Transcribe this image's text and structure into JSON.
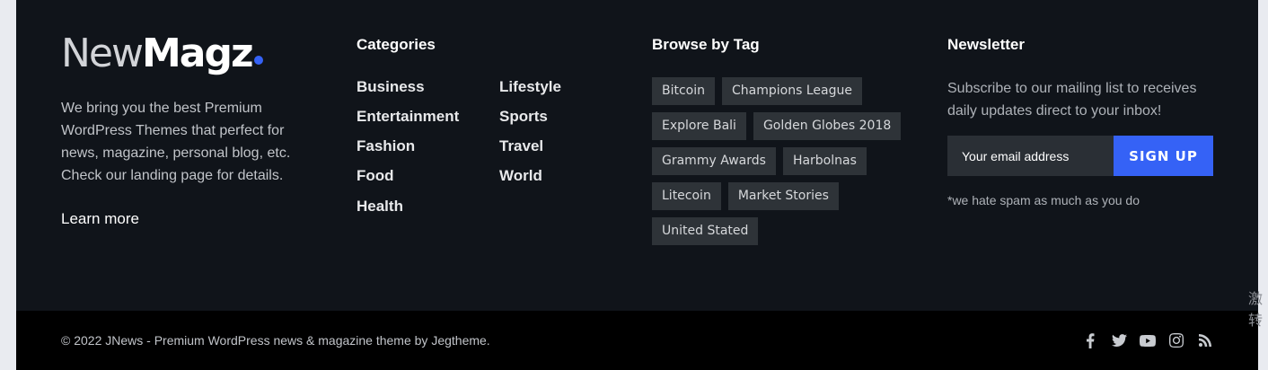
{
  "brand": {
    "logo_part1": "New",
    "logo_part2": "Magz"
  },
  "about": {
    "text": "We bring you the best Premium WordPress Themes that perfect for news, magazine, personal blog, etc. Check our landing page for details.",
    "learn_more": "Learn more"
  },
  "categories": {
    "title": "Categories",
    "col1": [
      "Business",
      "Entertainment",
      "Fashion",
      "Food",
      "Health"
    ],
    "col2": [
      "Lifestyle",
      "Sports",
      "Travel",
      "World"
    ]
  },
  "tags": {
    "title": "Browse by Tag",
    "items": [
      "Bitcoin",
      "Champions League",
      "Explore Bali",
      "Golden Globes 2018",
      "Grammy Awards",
      "Harbolnas",
      "Litecoin",
      "Market Stories",
      "United Stated"
    ]
  },
  "newsletter": {
    "title": "Newsletter",
    "description": "Subscribe to our mailing list to receives daily updates direct to your inbox!",
    "email_placeholder": "Your email address",
    "signup_label": "SIGN UP",
    "note": "*we hate spam as much as you do"
  },
  "bottom": {
    "copyright": "© 2022 JNews - Premium WordPress news & magazine theme by Jegtheme.",
    "social": [
      "facebook-icon",
      "twitter-icon",
      "youtube-icon",
      "instagram-icon",
      "rss-icon"
    ]
  },
  "side_text": {
    "line1": "激",
    "line2": "转"
  },
  "colors": {
    "accent": "#3562f6",
    "footer_bg": "#10141a",
    "bottom_bg": "#000000",
    "tag_bg": "#2e3338"
  }
}
